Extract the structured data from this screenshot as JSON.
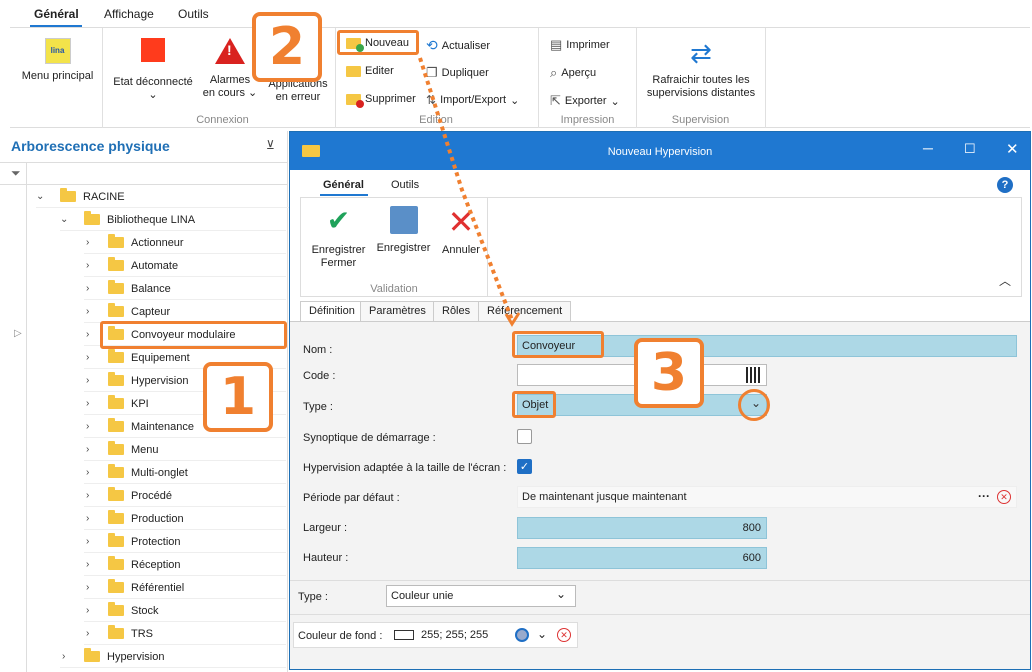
{
  "top_tabs": [
    "Général",
    "Affichage",
    "Outils"
  ],
  "ribbon": {
    "menu_principal": "Menu principal",
    "etat": "Etat déconnecté",
    "alarmes_1": "Alarmes",
    "alarmes_2": "en cours",
    "app_1": "Applications",
    "app_2": "en erreur",
    "connexion": "Connexion",
    "nouveau": "Nouveau",
    "editer": "Editer",
    "supprimer": "Supprimer",
    "actualiser": "Actualiser",
    "dupliquer": "Dupliquer",
    "import_export": "Import/Export",
    "edition": "Edition",
    "imprimer": "Imprimer",
    "apercu": "Aperçu",
    "exporter": "Exporter",
    "impression": "Impression",
    "rafraichir_1": "Rafraichir toutes les",
    "rafraichir_2": "supervisions distantes",
    "supervision": "Supervision",
    "logo_text": "lina"
  },
  "tree": {
    "title": "Arborescence physique",
    "root": "RACINE",
    "library": "Bibliotheque LINA",
    "items": [
      "Actionneur",
      "Automate",
      "Balance",
      "Capteur",
      "Convoyeur modulaire",
      "Equipement",
      "Hypervision",
      "KPI",
      "Maintenance",
      "Menu",
      "Multi-onglet",
      "Procédé",
      "Production",
      "Protection",
      "Réception",
      "Référentiel",
      "Stock",
      "TRS"
    ],
    "bottom": "Hypervision"
  },
  "dialog": {
    "title": "Nouveau Hypervision",
    "tabs": [
      "Général",
      "Outils"
    ],
    "save_close_1": "Enregistrer",
    "save_close_2": "Fermer",
    "save": "Enregistrer",
    "cancel": "Annuler",
    "validation": "Validation",
    "subtabs": [
      "Définition",
      "Paramètres",
      "Rôles",
      "Référencement"
    ],
    "labels": {
      "nom": "Nom :",
      "code": "Code :",
      "type": "Type :",
      "synoptique": "Synoptique de démarrage :",
      "adaptee": "Hypervision adaptée à la taille de l'écran :",
      "periode": "Période par défaut :",
      "largeur": "Largeur :",
      "hauteur": "Hauteur :",
      "type2": "Type :",
      "couleur": "Couleur de fond :"
    },
    "values": {
      "nom": "Convoyeur",
      "code": "",
      "type": "Objet",
      "periode": "De maintenant jusque maintenant",
      "largeur": "800",
      "hauteur": "600",
      "type2": "Couleur unie",
      "couleur": "255; 255; 255"
    },
    "synoptique_checked": false,
    "adaptee_checked": true
  },
  "badges": [
    "1",
    "2",
    "3"
  ],
  "colors": {
    "accent": "#1f78d1",
    "highlight": "#f08030",
    "field_blue": "#add8e6"
  }
}
